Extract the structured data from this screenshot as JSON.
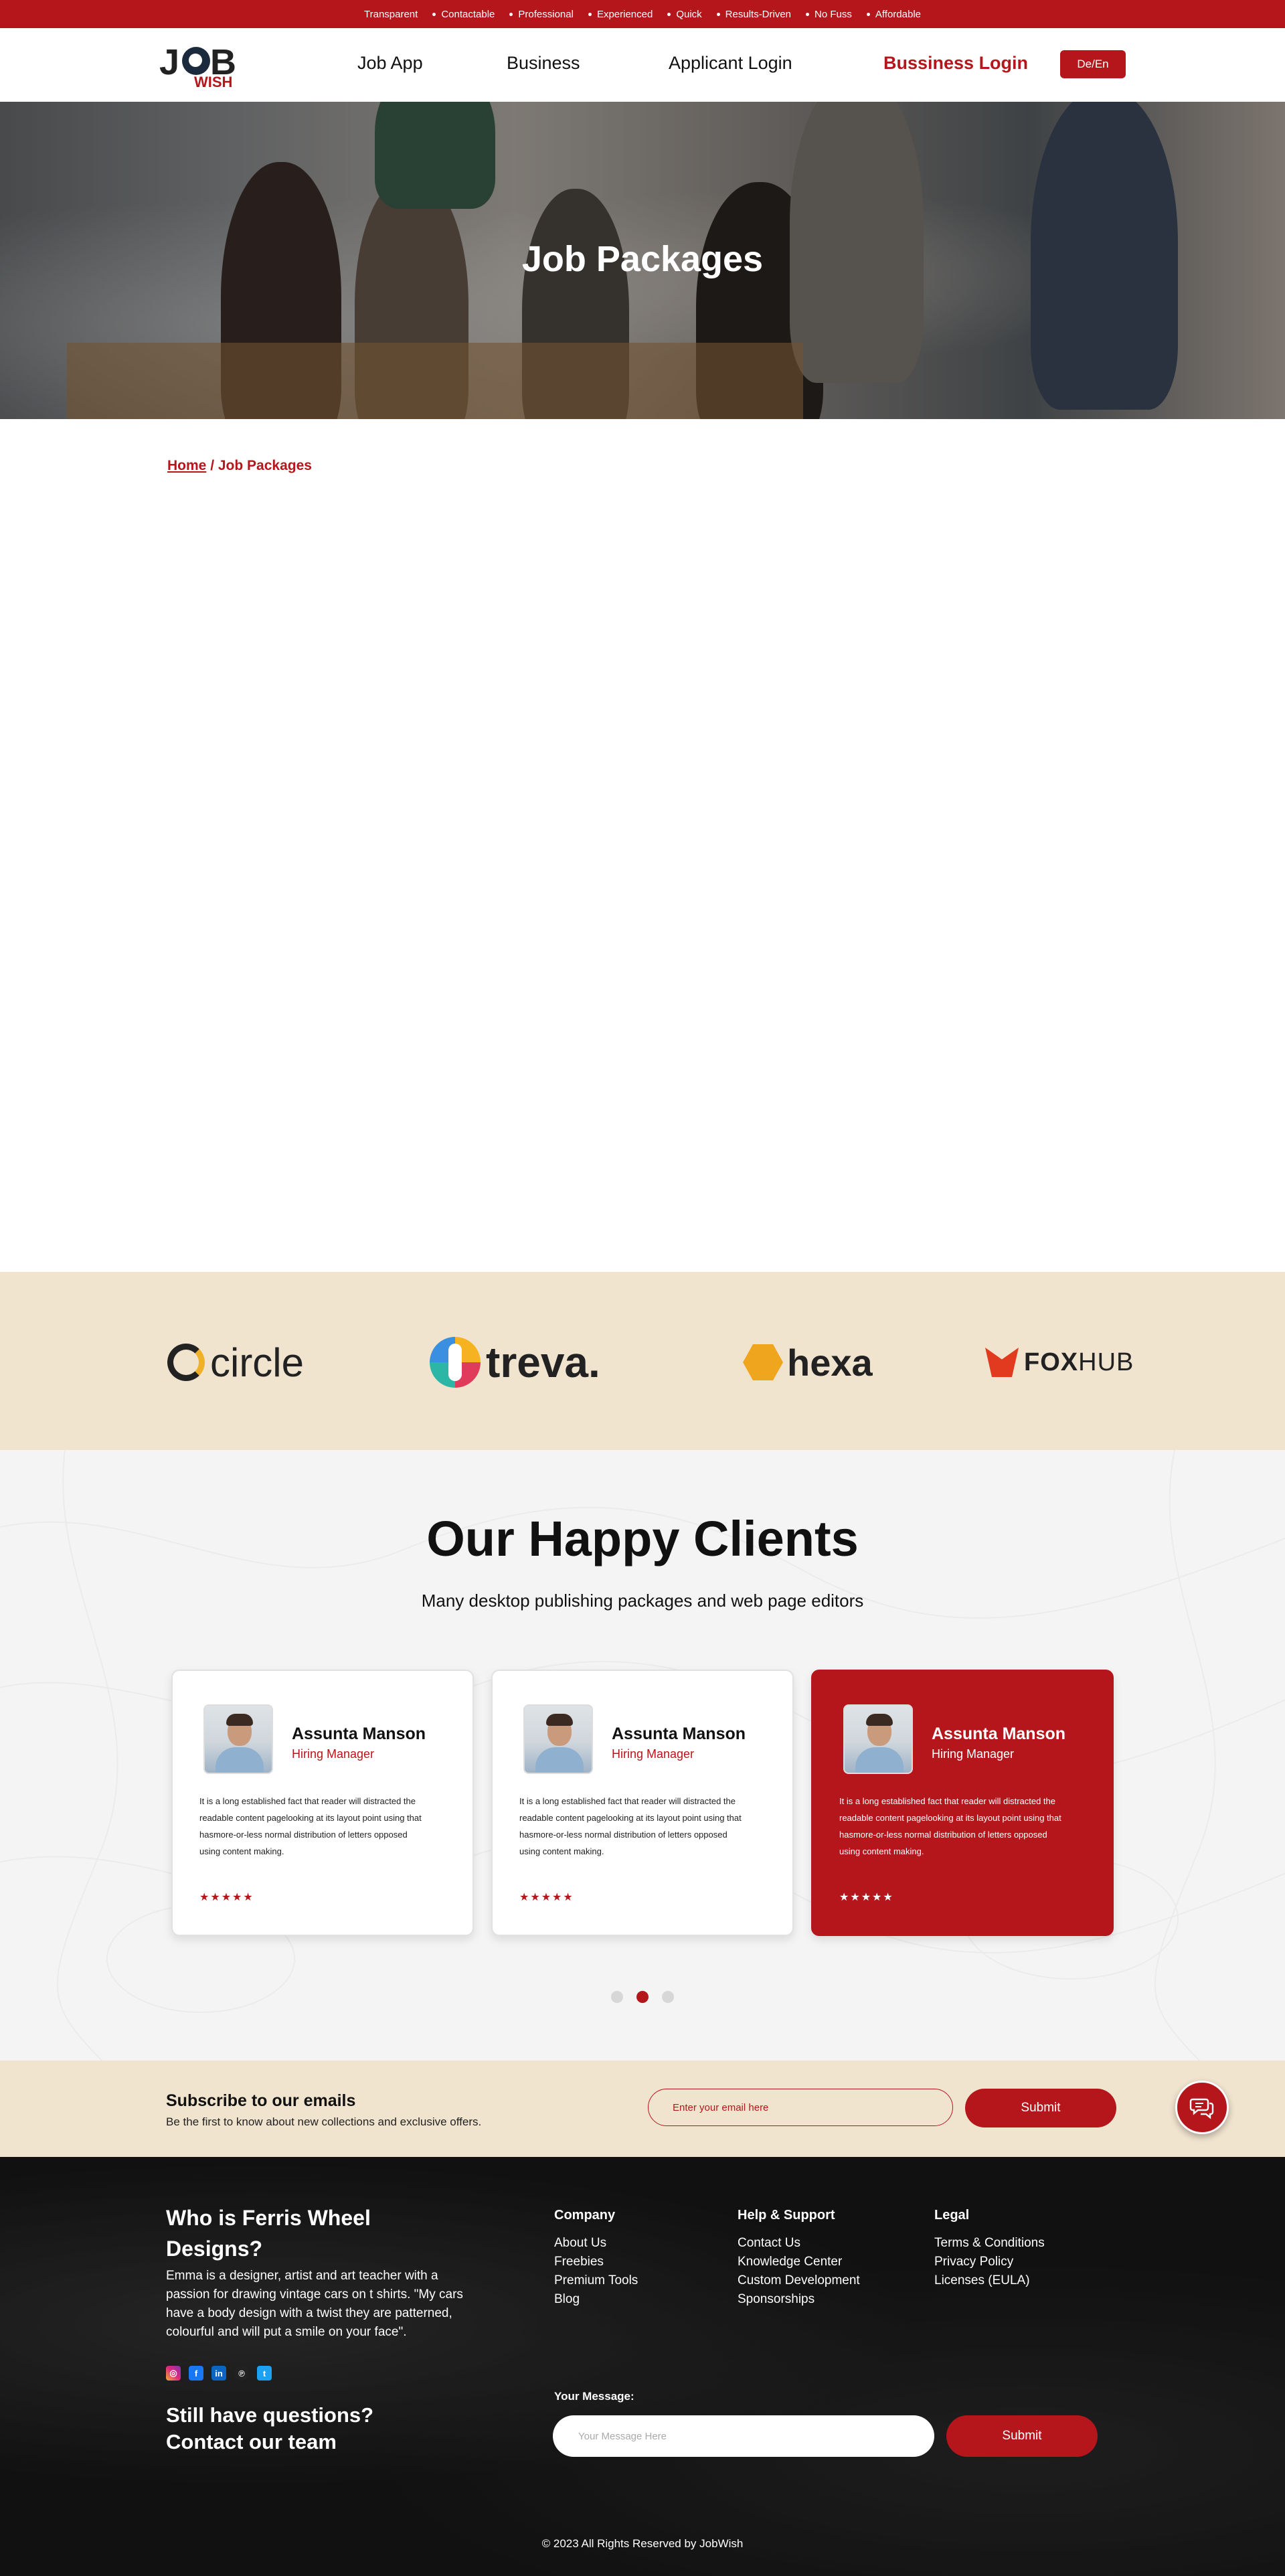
{
  "topbar": {
    "items": [
      "Transparent",
      "Contactable",
      "Professional",
      "Experienced",
      "Quick",
      "Results-Driven",
      "No Fuss",
      "Affordable"
    ]
  },
  "brand": {
    "logo_main": "JOB",
    "logo_sub": "WISH"
  },
  "nav": {
    "items": [
      {
        "label": "Job App"
      },
      {
        "label": "Business"
      },
      {
        "label": "Applicant Login"
      },
      {
        "label": "Bussiness Login"
      }
    ],
    "lang_button": "De/En"
  },
  "hero": {
    "title": "Job Packages"
  },
  "breadcrumb": {
    "home": "Home",
    "separator": " / ",
    "current": "Job Packages"
  },
  "partners": [
    {
      "name": "circle"
    },
    {
      "name": "treva."
    },
    {
      "name": "hexa"
    },
    {
      "name_a": "FOX",
      "name_b": "HUB"
    }
  ],
  "testimonials": {
    "title": "Our Happy Clients",
    "subtitle": "Many desktop publishing packages and web page editors",
    "cards": [
      {
        "name": "Assunta Manson",
        "role": "Hiring Manager",
        "text": "It is a long established fact that reader will distracted the readable content pagelooking at its layout point using that hasmore-or-less normal distribution of letters opposed using content making.",
        "stars": "★★★★★"
      },
      {
        "name": "Assunta Manson",
        "role": "Hiring Manager",
        "text": "It is a long established fact that reader will distracted the readable content pagelooking at its layout point using that hasmore-or-less normal distribution of letters opposed using content making.",
        "stars": "★★★★★"
      },
      {
        "name": "Assunta Manson",
        "role": "Hiring Manager",
        "text": "It is a long established fact that reader will distracted the readable content pagelooking at its layout point using that hasmore-or-less normal distribution of letters opposed using content making.",
        "stars": "★★★★★"
      }
    ],
    "active_dot": 1
  },
  "subscribe": {
    "title": "Subscribe to our emails",
    "description": "Be the first to know about new collections and exclusive offers.",
    "placeholder": "Enter your email here",
    "button": "Submit"
  },
  "footer": {
    "heading": "Who is Ferris Wheel Designs?",
    "about": "Emma is a designer, artist and art teacher with a passion for drawing vintage cars on t shirts. \"My cars have a body design with a twist they are patterned, colourful and will put a smile on your face\".",
    "social": [
      "instagram-icon",
      "facebook-icon",
      "linkedin-icon",
      "pinterest-icon",
      "twitter-icon"
    ],
    "questions_line1": "Still have questions?",
    "questions_line2": "Contact our team",
    "columns": [
      {
        "title": "Company",
        "links": [
          "About Us",
          "Freebies",
          "Premium Tools",
          "Blog"
        ]
      },
      {
        "title": "Help & Support",
        "links": [
          "Contact Us",
          "Knowledge Center",
          "Custom Development",
          "Sponsorships"
        ]
      },
      {
        "title": "Legal",
        "links": [
          "Terms & Conditions",
          "Privacy Policy",
          "Licenses (EULA)"
        ]
      }
    ],
    "message_label": "Your Message:",
    "message_placeholder": "Your Message Here",
    "message_button": "Submit",
    "copyright": "© 2023 All Rights Reserved by JobWish"
  },
  "colors": {
    "brand_red": "#b5161c",
    "cream": "#f1e4cf"
  }
}
